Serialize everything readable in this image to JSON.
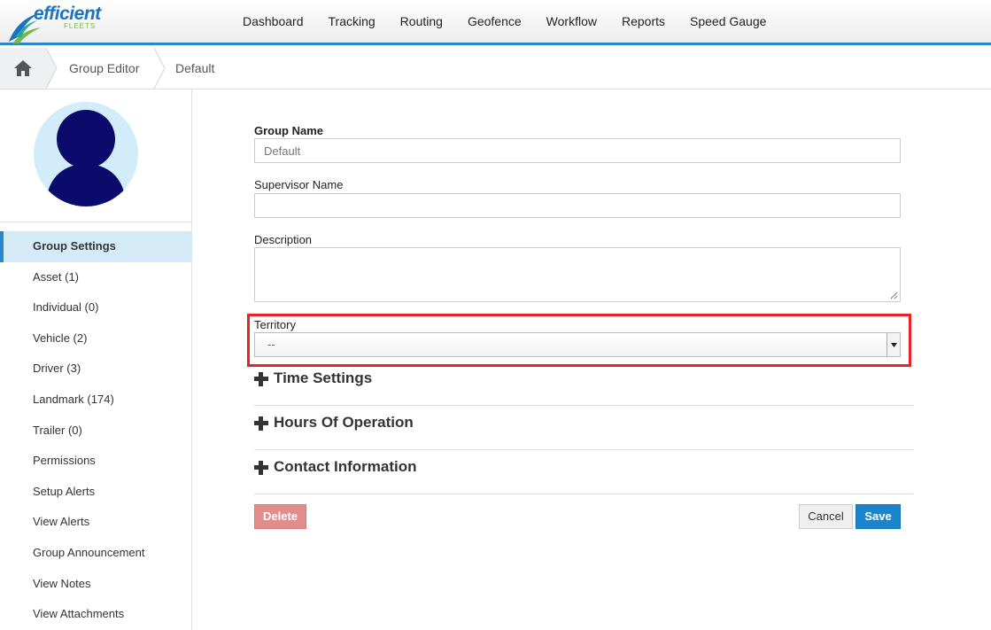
{
  "logo": {
    "word": "efficient",
    "sub": "FLEETS"
  },
  "nav": [
    "Dashboard",
    "Tracking",
    "Routing",
    "Geofence",
    "Workflow",
    "Reports",
    "Speed Gauge"
  ],
  "breadcrumb": [
    "Group Editor",
    "Default"
  ],
  "sidebar": {
    "items": [
      {
        "label": "Group Settings",
        "active": true
      },
      {
        "label": "Asset (1)"
      },
      {
        "label": "Individual (0)"
      },
      {
        "label": "Vehicle (2)"
      },
      {
        "label": "Driver (3)"
      },
      {
        "label": "Landmark (174)"
      },
      {
        "label": "Trailer (0)"
      },
      {
        "label": "Permissions"
      },
      {
        "label": "Setup Alerts"
      },
      {
        "label": "View Alerts"
      },
      {
        "label": "Group Announcement"
      },
      {
        "label": "View Notes"
      },
      {
        "label": "View Attachments"
      }
    ]
  },
  "form": {
    "group_name_label": "Group Name",
    "group_name_value": "Default",
    "supervisor_label": "Supervisor Name",
    "supervisor_value": "",
    "description_label": "Description",
    "territory_label": "Territory",
    "territory_value": "--",
    "sections": [
      "Time Settings",
      "Hours Of Operation",
      "Contact Information"
    ],
    "delete_label": "Delete",
    "cancel_label": "Cancel",
    "save_label": "Save"
  },
  "colors": {
    "accent": "#2a86c8",
    "save": "#1a84cc",
    "delete": "#e38c8c",
    "highlight_frame": "#e8232a",
    "avatar_bg": "#d3ecf9",
    "avatar_fg": "#0b0b6b"
  }
}
